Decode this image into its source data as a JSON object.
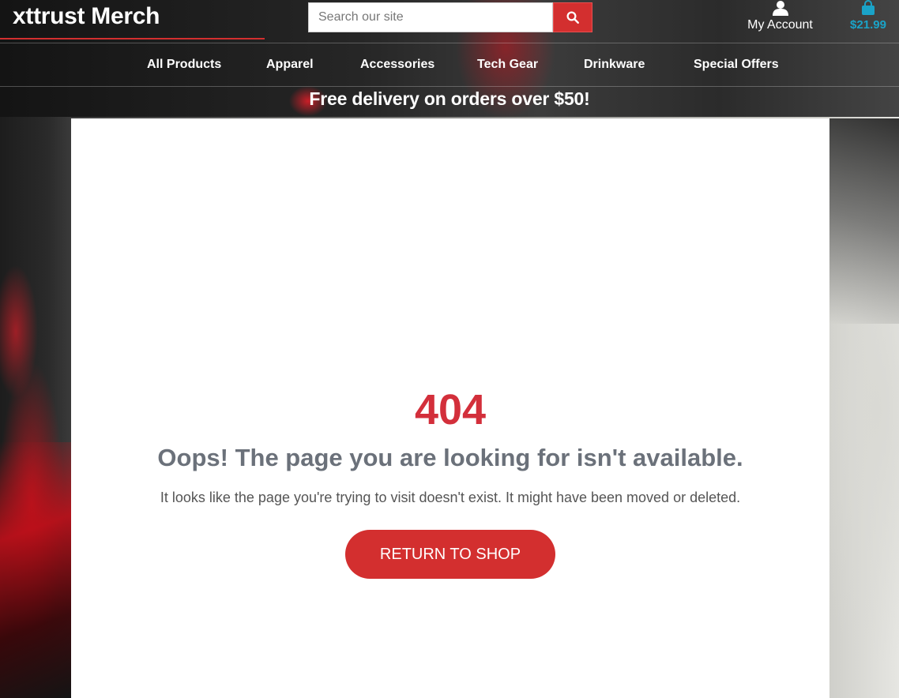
{
  "brand": {
    "name": "xttrust Merch"
  },
  "search": {
    "placeholder": "Search our site",
    "button_icon": "search-icon"
  },
  "account": {
    "label": "My Account",
    "icon": "user-icon"
  },
  "cart": {
    "total": "$21.99",
    "icon": "shopping-bag-icon"
  },
  "nav": {
    "items": [
      {
        "label": "All Products"
      },
      {
        "label": "Apparel"
      },
      {
        "label": "Accessories"
      },
      {
        "label": "Tech Gear"
      },
      {
        "label": "Drinkware"
      },
      {
        "label": "Special Offers"
      }
    ]
  },
  "promo": {
    "text": "Free delivery on orders over $50!"
  },
  "error": {
    "code": "404",
    "title": "Oops! The page you are looking for isn't available.",
    "message": "It looks like the page you're trying to visit doesn't exist. It might have been moved or deleted.",
    "button_label": "RETURN TO SHOP"
  },
  "colors": {
    "accent": "#d32f2f",
    "error_code": "#d32f3b",
    "cart_total": "#1aa3c8",
    "title_gray": "#6b717a"
  }
}
